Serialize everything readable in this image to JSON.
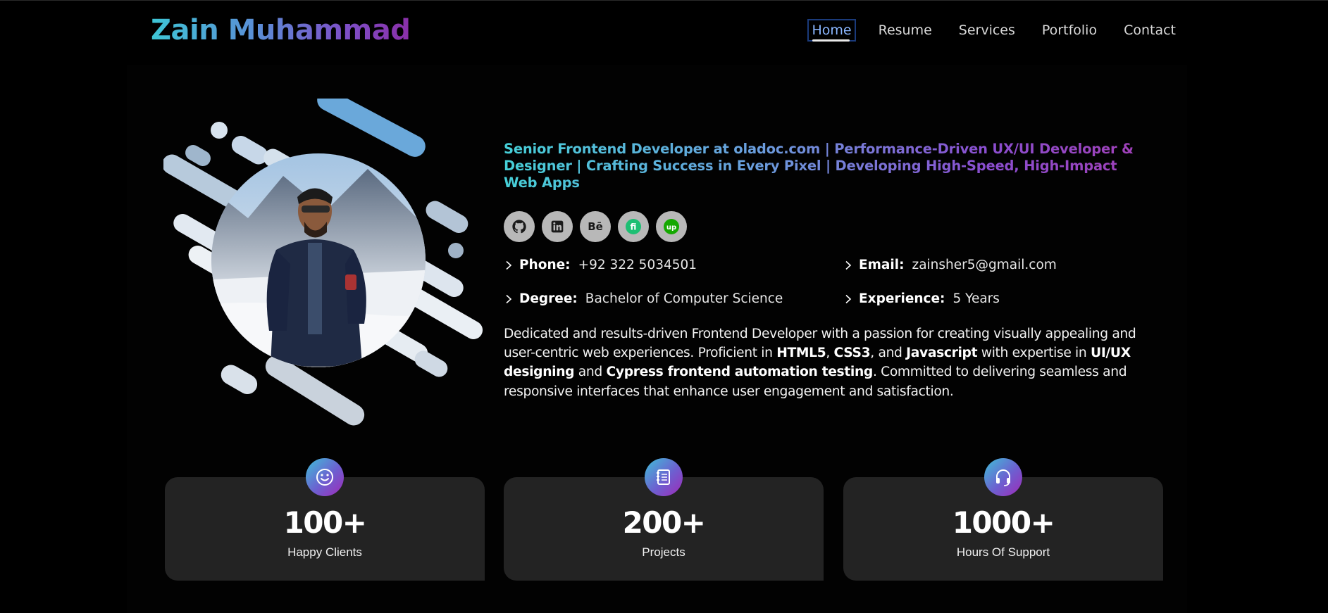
{
  "header": {
    "brand": "Zain Muhammad",
    "nav": [
      {
        "label": "Home",
        "active": true
      },
      {
        "label": "Resume",
        "active": false
      },
      {
        "label": "Services",
        "active": false
      },
      {
        "label": "Portfolio",
        "active": false
      },
      {
        "label": "Contact",
        "active": false
      }
    ]
  },
  "profile": {
    "headline": "Senior Frontend Developer at oladoc.com | Performance-Driven UX/UI Developer & Designer | Crafting Success in Every Pixel | Developing High-Speed, High-Impact Web Apps",
    "socials": [
      {
        "icon": "github-icon"
      },
      {
        "icon": "linkedin-icon"
      },
      {
        "icon": "behance-icon"
      },
      {
        "icon": "fiverr-icon"
      },
      {
        "icon": "upwork-icon"
      }
    ],
    "facts": {
      "phone_label": "Phone:",
      "phone": "+92 322 5034501",
      "email_label": "Email:",
      "email": "zainsher5@gmail.com",
      "degree_label": "Degree:",
      "degree": "Bachelor of Computer Science",
      "experience_label": "Experience:",
      "experience": "5 Years"
    },
    "about": {
      "p1": "Dedicated and results-driven Frontend Developer with a passion for creating visually appealing and user-centric web experiences. Proficient in ",
      "b1": "HTML5",
      "p2": ", ",
      "b2": "CSS3",
      "p3": ", and ",
      "b3": "Javascript",
      "p4": " with expertise in ",
      "b4": "UI/UX designing",
      "p5": " and ",
      "b5": "Cypress frontend automation testing",
      "p6": ". Committed to delivering seamless and responsive interfaces that enhance user engagement and satisfaction."
    }
  },
  "stats": [
    {
      "value": "100+",
      "label": "Happy Clients",
      "icon": "smile-icon"
    },
    {
      "value": "200+",
      "label": "Projects",
      "icon": "notebook-icon"
    },
    {
      "value": "1000+",
      "label": "Hours Of Support",
      "icon": "headset-icon"
    }
  ],
  "colors": {
    "background": "#000000",
    "card": "#232323",
    "gradient_start": "#3ec6d6",
    "gradient_end": "#8a2fa8",
    "nav_active": "#8ab6ff"
  }
}
